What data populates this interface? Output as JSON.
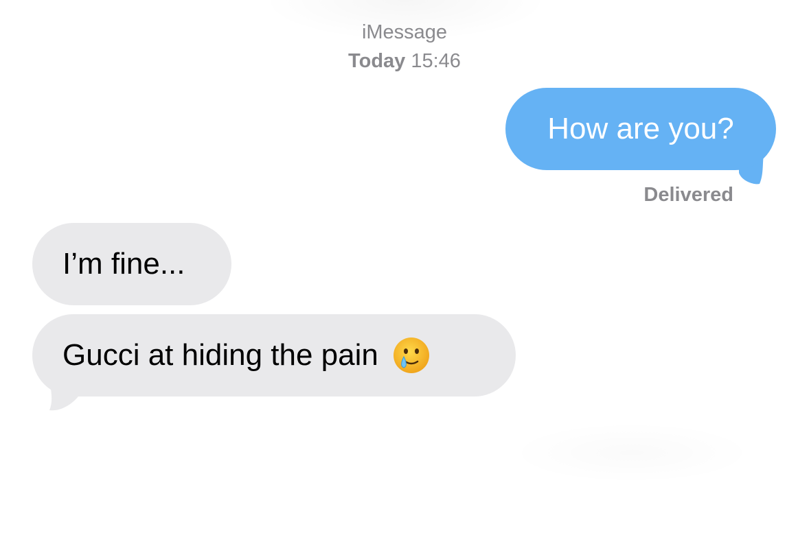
{
  "header": {
    "service": "iMessage",
    "timestamp_day": "Today",
    "timestamp_time": "15:46"
  },
  "messages": [
    {
      "direction": "outgoing",
      "text": "How are you?",
      "status": "Delivered"
    },
    {
      "direction": "incoming",
      "text": "I’m fine..."
    },
    {
      "direction": "incoming",
      "text": "Gucci at hiding the pain",
      "emoji": "face-holding-back-tears-icon"
    }
  ],
  "colors": {
    "outgoing_bubble": "#65b2f4",
    "incoming_bubble": "#e9e9eb",
    "meta_text": "#8a8a8e"
  }
}
